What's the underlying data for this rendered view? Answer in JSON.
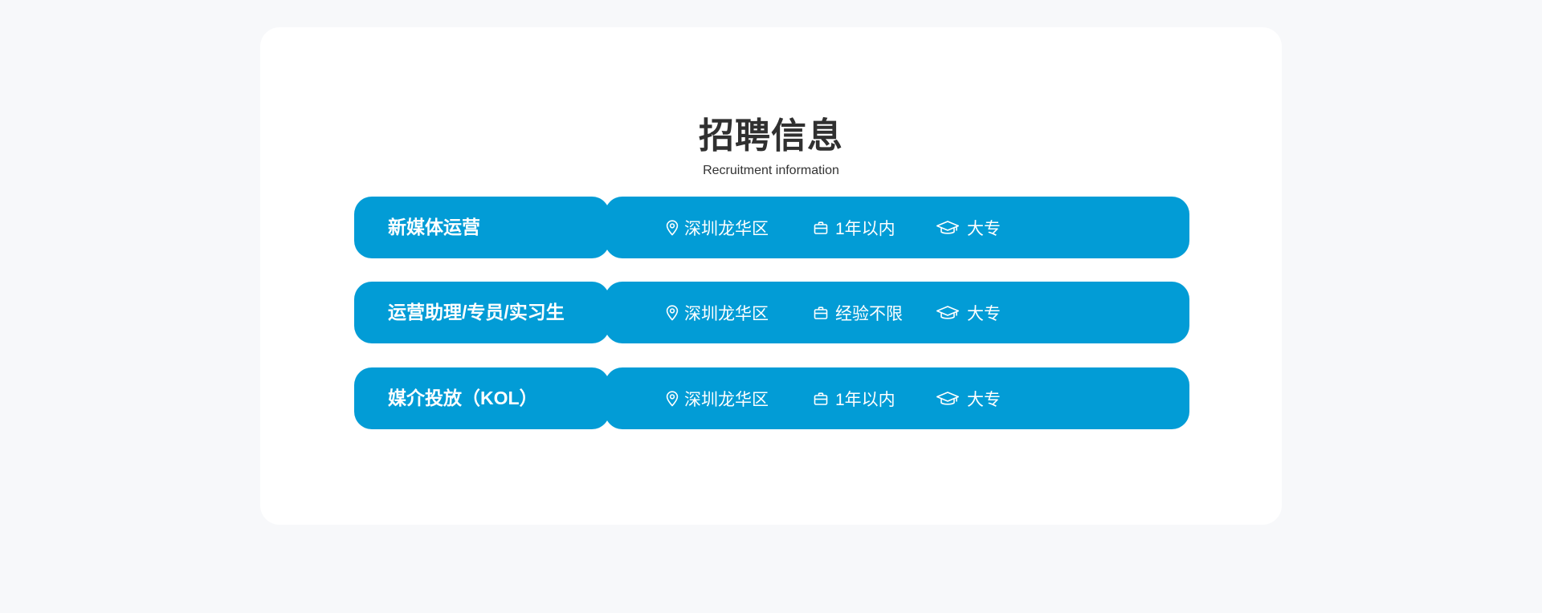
{
  "header": {
    "title": "招聘信息",
    "subtitle": "Recruitment information"
  },
  "jobs": [
    {
      "name": "新媒体运营",
      "location": "深圳龙华区",
      "experience": "1年以内",
      "education": "大专"
    },
    {
      "name": "运营助理/专员/实习生",
      "location": "深圳龙华区",
      "experience": "经验不限",
      "education": "大专"
    },
    {
      "name": "媒介投放（KOL）",
      "location": "深圳龙华区",
      "experience": "1年以内",
      "education": "大专"
    }
  ],
  "icons": {
    "location": "location-pin-icon",
    "experience": "briefcase-icon",
    "education": "graduation-cap-icon"
  },
  "colors": {
    "page_background": "#f7f8fa",
    "card_background": "#ffffff",
    "accent": "#029cd6",
    "title_text": "#303030"
  }
}
